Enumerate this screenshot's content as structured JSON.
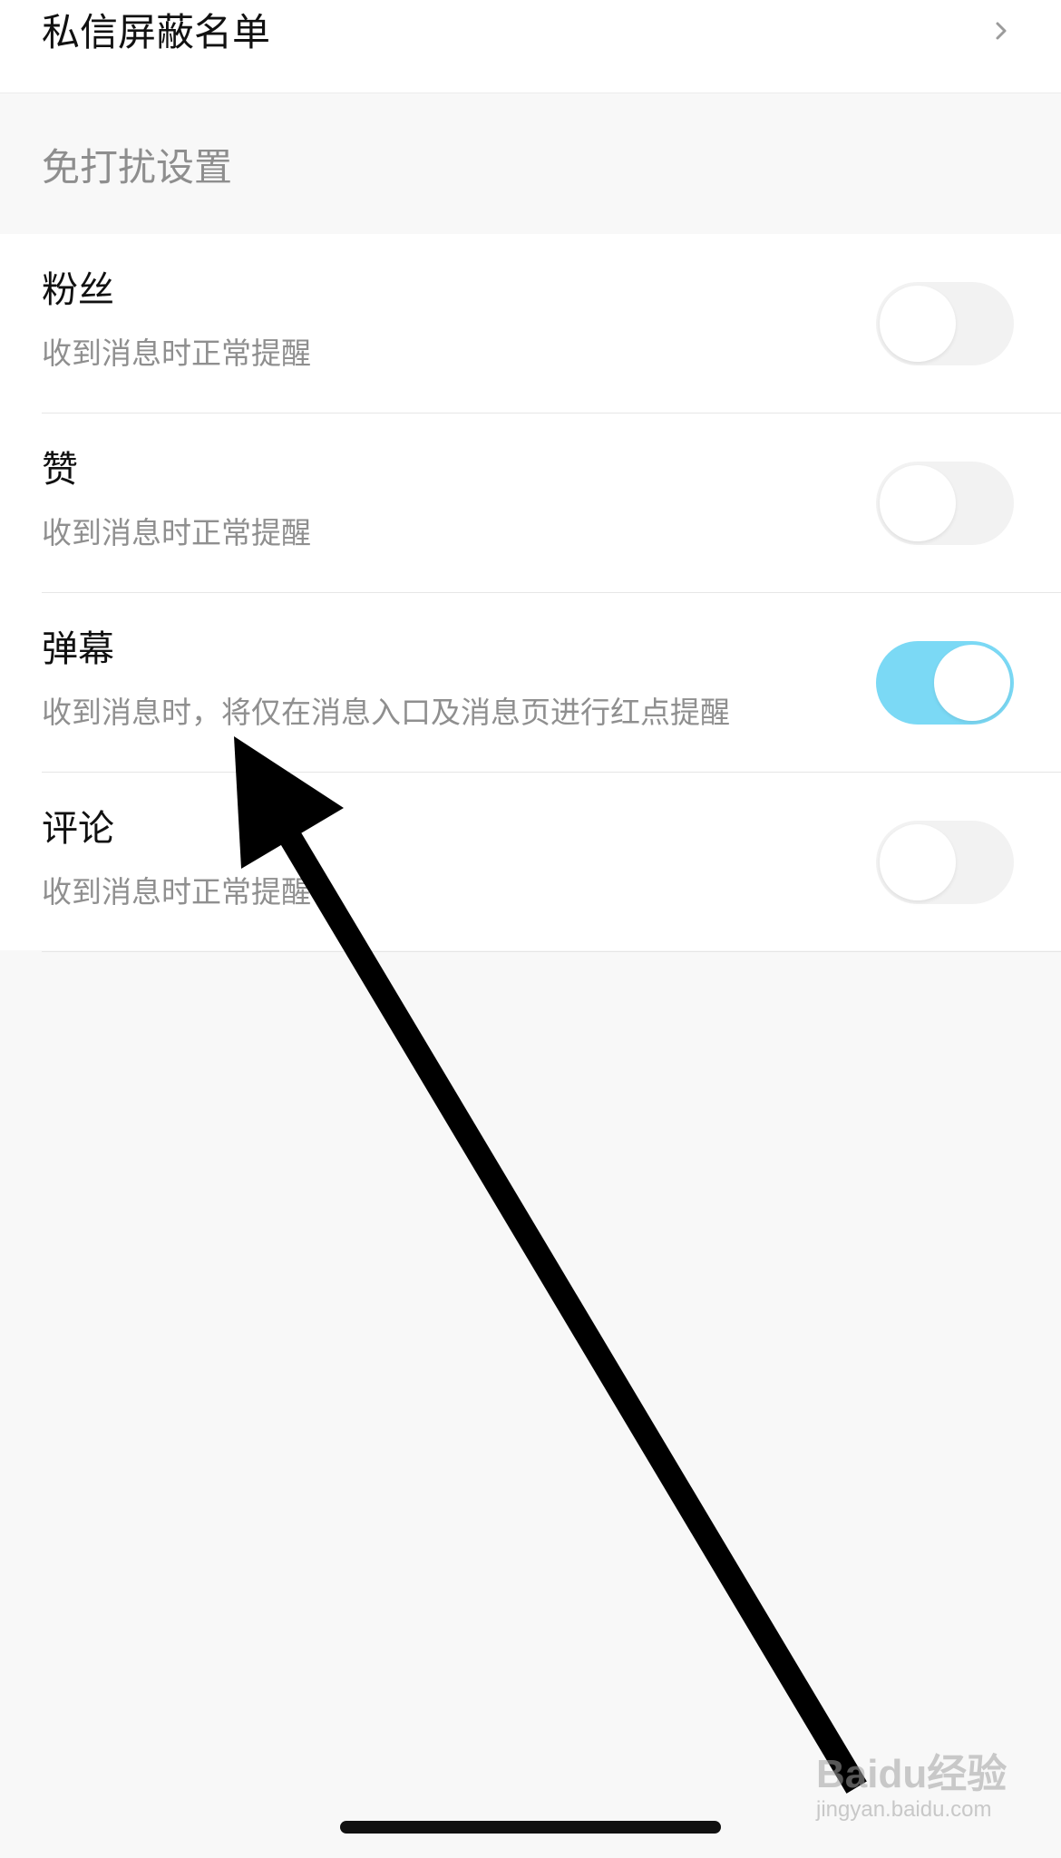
{
  "top_row": {
    "title": "私信屏蔽名单",
    "chevron_icon": "chevron-right-icon"
  },
  "section_header": {
    "label": "免打扰设置"
  },
  "settings": [
    {
      "name": "粉丝",
      "description": "收到消息时正常提醒",
      "enabled": false
    },
    {
      "name": "赞",
      "description": "收到消息时正常提醒",
      "enabled": false
    },
    {
      "name": "弹幕",
      "description": "收到消息时，将仅在消息入口及消息页进行红点提醒",
      "enabled": true
    },
    {
      "name": "评论",
      "description": "收到消息时正常提醒",
      "enabled": false
    }
  ],
  "colors": {
    "toggle_on": "#7bd9f5",
    "toggle_off": "#f2f2f2",
    "arrow": "#000000"
  },
  "watermark": {
    "brand": "Baidu经验",
    "url": "jingyan.baidu.com"
  }
}
